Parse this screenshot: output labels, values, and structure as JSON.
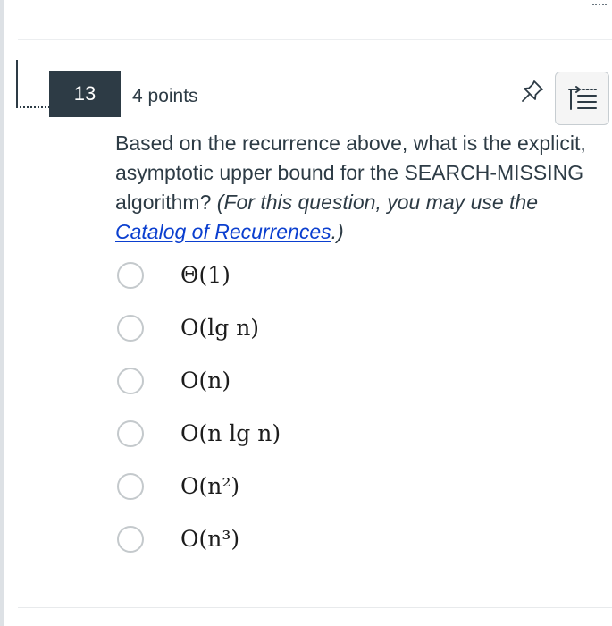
{
  "question": {
    "number": "13",
    "points": "4 points",
    "text_prefix": "Based on the recurrence above, what is the explicit, asymptotic upper bound for the SEARCH-MISSING algorithm? ",
    "text_italic_prefix": "(For this question, you may use the ",
    "link_text": "Catalog of Recurrences",
    "text_italic_suffix": ".)"
  },
  "answers": [
    {
      "label": "Θ(1)",
      "selected": false
    },
    {
      "label": "O(lg n)",
      "selected": false
    },
    {
      "label": "O(n)",
      "selected": false
    },
    {
      "label": "O(n lg n)",
      "selected": false
    },
    {
      "label": "O(n²)",
      "selected": false
    },
    {
      "label": "O(n³)",
      "selected": false
    }
  ],
  "icons": {
    "pin": "pin-icon",
    "menu": "list-menu-icon"
  },
  "colors": {
    "number_badge_bg": "#2d3b45",
    "link": "#0b3fcf",
    "text": "#2d3b45"
  }
}
